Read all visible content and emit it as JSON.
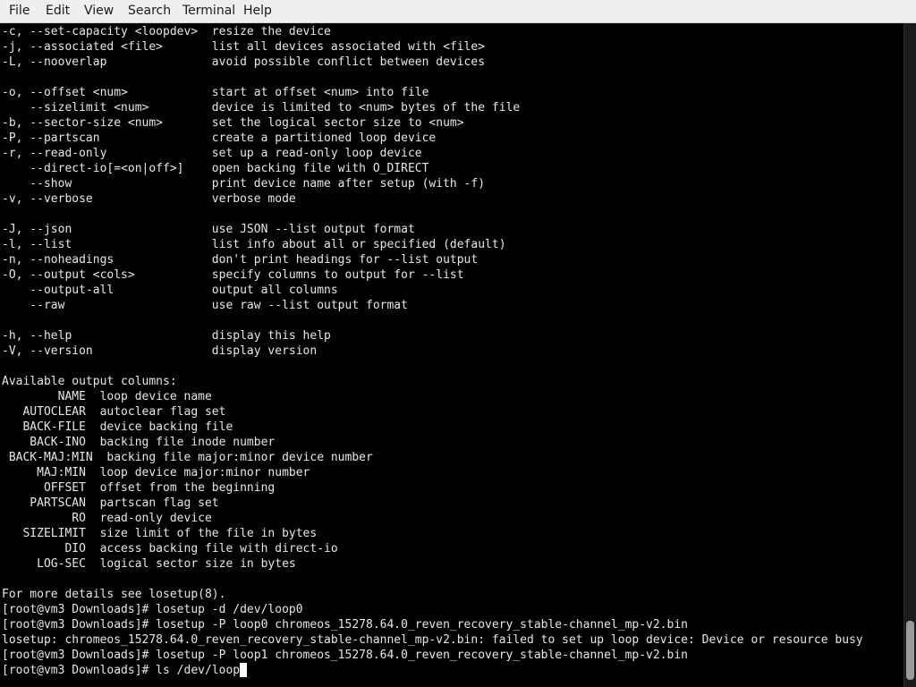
{
  "menu": {
    "items": [
      "File",
      "Edit",
      "View",
      "Search",
      "Terminal",
      "Help"
    ]
  },
  "terminal": {
    "lines": [
      "-c, --set-capacity <loopdev>  resize the device",
      "-j, --associated <file>       list all devices associated with <file>",
      "-L, --nooverlap               avoid possible conflict between devices",
      "",
      "-o, --offset <num>            start at offset <num> into file",
      "    --sizelimit <num>         device is limited to <num> bytes of the file",
      "-b, --sector-size <num>       set the logical sector size to <num>",
      "-P, --partscan                create a partitioned loop device",
      "-r, --read-only               set up a read-only loop device",
      "    --direct-io[=<on|off>]    open backing file with O_DIRECT",
      "    --show                    print device name after setup (with -f)",
      "-v, --verbose                 verbose mode",
      "",
      "-J, --json                    use JSON --list output format",
      "-l, --list                    list info about all or specified (default)",
      "-n, --noheadings              don't print headings for --list output",
      "-O, --output <cols>           specify columns to output for --list",
      "    --output-all              output all columns",
      "    --raw                     use raw --list output format",
      "",
      "-h, --help                    display this help",
      "-V, --version                 display version",
      "",
      "Available output columns:",
      "        NAME  loop device name",
      "   AUTOCLEAR  autoclear flag set",
      "   BACK-FILE  device backing file",
      "    BACK-INO  backing file inode number",
      " BACK-MAJ:MIN  backing file major:minor device number",
      "     MAJ:MIN  loop device major:minor number",
      "      OFFSET  offset from the beginning",
      "    PARTSCAN  partscan flag set",
      "          RO  read-only device",
      "   SIZELIMIT  size limit of the file in bytes",
      "         DIO  access backing file with direct-io",
      "     LOG-SEC  logical sector size in bytes",
      "",
      "For more details see losetup(8).",
      "[root@vm3 Downloads]# losetup -d /dev/loop0",
      "[root@vm3 Downloads]# losetup -P loop0 chromeos_15278.64.0_reven_recovery_stable-channel_mp-v2.bin",
      "losetup: chromeos_15278.64.0_reven_recovery_stable-channel_mp-v2.bin: failed to set up loop device: Device or resource busy",
      "[root@vm3 Downloads]# losetup -P loop1 chromeos_15278.64.0_reven_recovery_stable-channel_mp-v2.bin",
      "[root@vm3 Downloads]# ls /dev/loop"
    ]
  }
}
